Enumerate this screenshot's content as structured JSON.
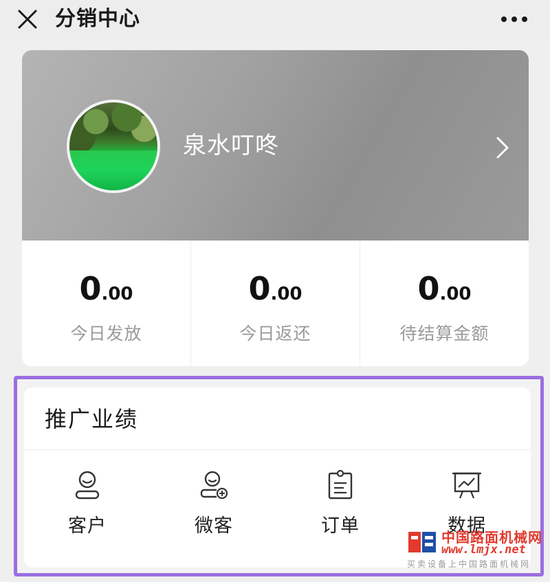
{
  "header": {
    "title": "分销中心",
    "close_icon": "close-icon",
    "more_icon": "more-dots-icon"
  },
  "profile": {
    "name": "泉水叮咚",
    "avatar": "avatar-landscape",
    "chevron_icon": "chevron-right-icon"
  },
  "stats": [
    {
      "int": "0",
      "dec": ".00",
      "label": "今日发放"
    },
    {
      "int": "0",
      "dec": ".00",
      "label": "今日返还"
    },
    {
      "int": "0",
      "dec": ".00",
      "label": "待结算金额"
    }
  ],
  "promo": {
    "title": "推广业绩",
    "items": [
      {
        "label": "客户",
        "icon": "user-icon"
      },
      {
        "label": "微客",
        "icon": "user-add-icon"
      },
      {
        "label": "订单",
        "icon": "clipboard-icon"
      },
      {
        "label": "数据",
        "icon": "chart-board-icon"
      }
    ]
  },
  "watermark": {
    "cn": "中国路面机械网",
    "url": "www.lmjx.net",
    "sub": "买卖设备上中国路面机械网"
  },
  "colors": {
    "highlight_border": "#9b6fe0",
    "profile_gradient": "#9a9a9a",
    "watermark_red": "#e23a2e"
  }
}
